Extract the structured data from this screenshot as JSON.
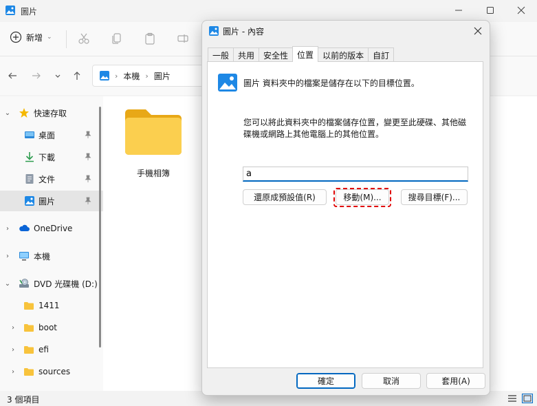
{
  "window": {
    "title": "圖片"
  },
  "toolbar": {
    "new_label": "新增"
  },
  "address": {
    "segments": [
      "本機",
      "圖片"
    ]
  },
  "sidebar": {
    "items": [
      {
        "label": "快速存取",
        "icon": "star-icon",
        "expandable": true
      },
      {
        "label": "桌面",
        "icon": "desktop-icon",
        "pinned": true
      },
      {
        "label": "下載",
        "icon": "download-icon",
        "pinned": true
      },
      {
        "label": "文件",
        "icon": "document-icon",
        "pinned": true
      },
      {
        "label": "圖片",
        "icon": "pictures-icon",
        "pinned": true,
        "selected": true
      },
      {
        "label": "OneDrive",
        "icon": "cloud-icon",
        "expandable": true
      },
      {
        "label": "本機",
        "icon": "computer-icon",
        "expandable": true
      },
      {
        "label": "DVD 光碟機 (D:)",
        "icon": "dvd-icon",
        "expandable": true,
        "expanded": true
      },
      {
        "label": "1411",
        "icon": "folder-icon"
      },
      {
        "label": "boot",
        "icon": "folder-icon",
        "expandable": true
      },
      {
        "label": "efi",
        "icon": "folder-icon",
        "expandable": true
      },
      {
        "label": "sources",
        "icon": "folder-icon",
        "expandable": true
      }
    ]
  },
  "content": {
    "folders": [
      {
        "label": "手機相簿"
      }
    ]
  },
  "status": {
    "count": "3 個項目"
  },
  "dialog": {
    "title": "圖片 - 內容",
    "tabs": [
      "一般",
      "共用",
      "安全性",
      "位置",
      "以前的版本",
      "自訂"
    ],
    "active_tab": "位置",
    "description": "圖片 資料夾中的檔案是儲存在以下的目標位置。",
    "paragraph": "您可以將此資料夾中的檔案儲存位置，變更至此硬碟、其他磁碟機或網路上其他電腦上的其他位置。",
    "path_value": "a",
    "restore_label": "還原成預設值(R)",
    "move_label": "移動(M)...",
    "find_label": "搜尋目標(F)...",
    "ok_label": "確定",
    "cancel_label": "取消",
    "apply_label": "套用(A)"
  },
  "colors": {
    "accent": "#0067c0",
    "highlight": "#e00000",
    "folder": "#f8c33c"
  }
}
